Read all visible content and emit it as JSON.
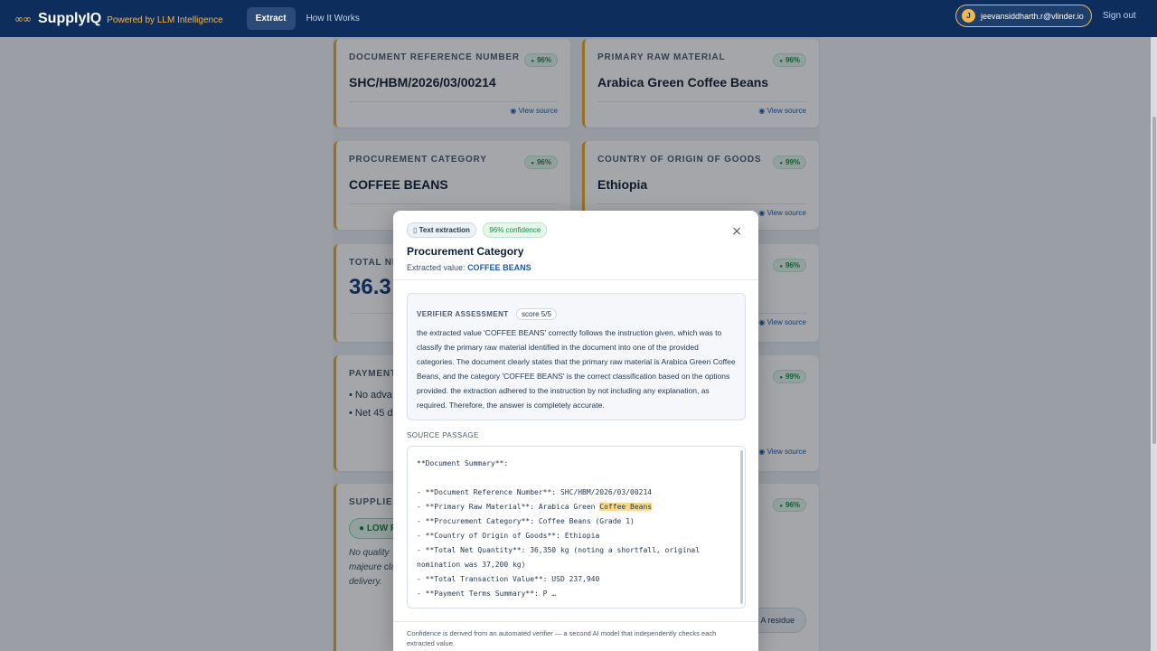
{
  "nav": {
    "logo_glyph": "∞∞",
    "brand": "SupplyIQ",
    "tagline": "Powered by LLM Intelligence",
    "tabs": [
      {
        "label": "Extract",
        "active": true
      },
      {
        "label": "How It Works",
        "active": false
      }
    ],
    "user": {
      "initial": "J",
      "email": "jeevansiddharth.r@vlinder.io"
    },
    "signout": "Sign out"
  },
  "cards": {
    "doc_ref": {
      "label": "Document Reference Number",
      "confidence": "96%",
      "value": "SHC/HBM/2026/03/00214",
      "link": "View source"
    },
    "raw_material": {
      "label": "Primary Raw Material",
      "confidence": "96%",
      "value": "Arabica Green Coffee Beans",
      "link": "View source"
    },
    "category": {
      "label": "Procurement Category",
      "confidence": "96%",
      "value": "COFFEE BEANS"
    },
    "origin": {
      "label": "Country of Origin of Goods",
      "confidence": "99%",
      "value": "Ethiopia",
      "link": "View source"
    },
    "quantity": {
      "label": "Total Ne",
      "confidence": "96%",
      "value": "36.3",
      "link": "View source"
    },
    "payment": {
      "label": "Payment",
      "confidence": "99%",
      "bullets": [
        "No adva",
        "Net 45 d"
      ],
      "link": "View source"
    },
    "supplier": {
      "label": "Supplier",
      "confidence": "96%",
      "risk": "LOW R",
      "note": [
        "No quality",
        "majeure cla",
        "delivery."
      ],
      "tag": "A residue"
    }
  },
  "modal": {
    "method_chip": "Text extraction",
    "confidence_chip": "96% confidence",
    "title": "Procurement Category",
    "extracted_label": "Extracted value:",
    "extracted_value": "COFFEE BEANS",
    "close": "×",
    "verifier": {
      "label": "VERIFIER ASSESSMENT",
      "score": "score 5/5",
      "text": "the extracted value 'COFFEE BEANS' correctly follows the instruction given, which was to classify the primary raw material identified in the document into one of the provided categories. The document clearly states that the primary raw material is Arabica Green Coffee Beans, and the category 'COFFEE BEANS' is the correct classification based on the options provided. the extraction adhered to the instruction by not including any explanation, as required. Therefore, the answer is completely accurate."
    },
    "source_label": "SOURCE PASSAGE",
    "source": {
      "line1": "**Document Summary**:",
      "line2": "- **Document Reference Number**: SHC/HBM/2026/03/00214",
      "line3_pre": "- **Primary Raw Material**: Arabica Green ",
      "line3_hl": "Coffee Beans",
      "line4": "- **Procurement Category**: Coffee Beans (Grade 1)",
      "line5": "- **Country of Origin of Goods**: Ethiopia",
      "line6": "- **Total Net Quantity**: 36,350 kg (noting a shortfall, original nomination was 37,200 kg)",
      "line7": "- **Total Transaction Value**: USD 237,940",
      "line8": "- **Payment Terms Summary**: P …"
    },
    "footer": "Confidence is derived from an automated verifier — a second AI model that independently checks each extracted value."
  }
}
